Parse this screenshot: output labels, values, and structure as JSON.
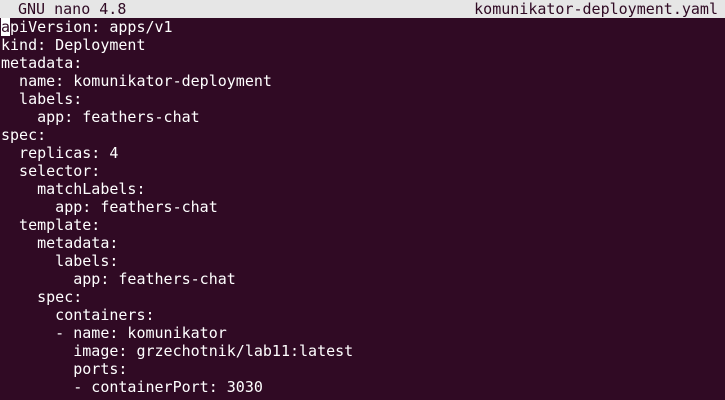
{
  "titlebar": {
    "app": "GNU nano 4.8",
    "filename": "komunikator-deployment.yaml"
  },
  "editor": {
    "cursor_char": "a",
    "first_line_rest": "piVersion: apps/v1",
    "lines": [
      "kind: Deployment",
      "metadata:",
      "  name: komunikator-deployment",
      "  labels:",
      "    app: feathers-chat",
      "spec:",
      "  replicas: 4",
      "  selector:",
      "    matchLabels:",
      "      app: feathers-chat",
      "  template:",
      "    metadata:",
      "      labels:",
      "        app: feathers-chat",
      "    spec:",
      "      containers:",
      "      - name: komunikator",
      "        image: grzechotnik/lab11:latest",
      "        ports:",
      "        - containerPort: 3030"
    ]
  },
  "colors": {
    "background": "#300a24",
    "titlebar_bg": "#e6e6e6",
    "text": "#ffffff"
  }
}
